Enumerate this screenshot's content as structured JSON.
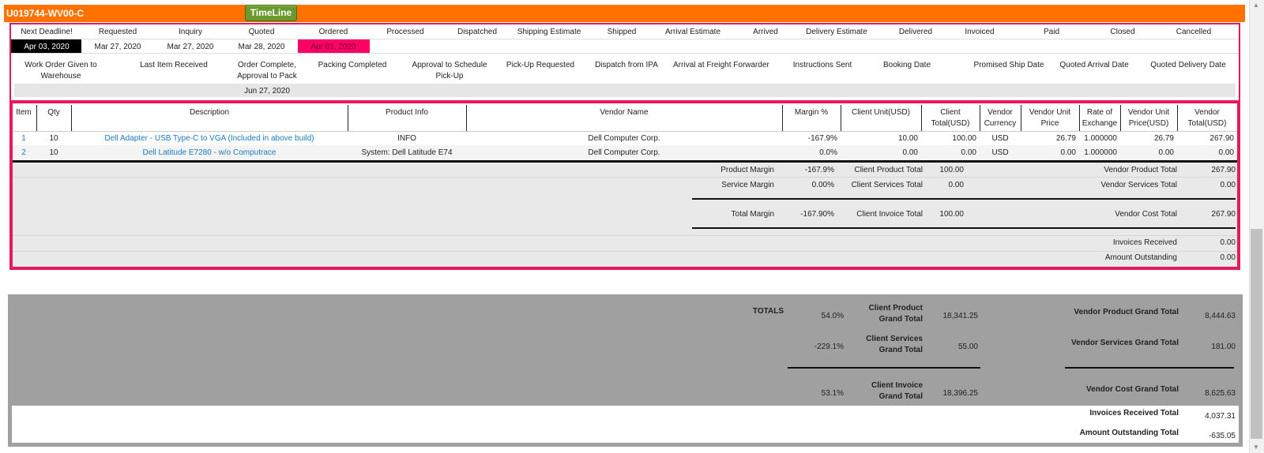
{
  "order": {
    "id": "U019744-WV00-C",
    "timeline_label": "TimeLine"
  },
  "status_headers": [
    "Next Deadline!",
    "Requested",
    "Inquiry",
    "Quoted",
    "Ordered",
    "Processed",
    "Dispatched",
    "Shipping Estimate",
    "Shipped",
    "Arrival Estimate",
    "Arrived",
    "Delivery Estimate",
    "Delivered",
    "Invoiced",
    "Paid",
    "Closed",
    "Cancelled"
  ],
  "status_values": [
    "Apr 03, 2020",
    "Mar 27, 2020",
    "Mar 27, 2020",
    "Mar 28, 2020",
    "Apr 01, 2020"
  ],
  "milestone_headers": [
    "Work Order Given to Warehouse",
    "Last Item Received",
    "Order Complete, Approval to Pack",
    "Packing Completed",
    "Approval to Schedule Pick-Up",
    "Pick-Up Requested",
    "Dispatch from IPA",
    "Arrival at Freight Forwarder",
    "Instructions Sent",
    "Booking Date",
    "Promised Ship Date",
    "Quoted Arrival Date",
    "Quoted Delivery Date"
  ],
  "milestone_values": {
    "order_complete": "Jun 27, 2020"
  },
  "items_table": {
    "headers": [
      "Item",
      "Qty",
      "Description",
      "Product Info",
      "Vendor Name",
      "Margin %",
      "Client Unit(USD)",
      "Client Total(USD)",
      "Vendor Currency",
      "Vendor Unit Price",
      "Rate of Exchange",
      "Vendor Unit Price(USD)",
      "Vendor Total(USD)"
    ],
    "rows": [
      [
        "1",
        "10",
        "Dell Adapter - USB Type-C to VGA (Included in above build)",
        "INFO",
        "Dell Computer Corp.",
        "-167.9%",
        "10.00",
        "100.00",
        "USD",
        "26.79",
        "1.000000",
        "26.79",
        "267.90"
      ],
      [
        "2",
        "10",
        "Dell Latitude E7280 - w/o Computrace",
        "System: Dell Latitude E74",
        "Dell Computer Corp.",
        "0.0%",
        "0.00",
        "0.00",
        "USD",
        "0.00",
        "1.000000",
        "0.00",
        "0.00"
      ]
    ]
  },
  "summary": {
    "product_margin_label": "Product Margin",
    "product_margin": "-167.9%",
    "client_product_total_label": "Client Product Total",
    "client_product_total": "100.00",
    "vendor_product_total_label": "Vendor Product Total",
    "vendor_product_total": "267.90",
    "service_margin_label": "Service Margin",
    "service_margin": "0.00%",
    "client_services_total_label": "Client Services Total",
    "client_services_total": "0.00",
    "vendor_services_total_label": "Vendor Services Total",
    "vendor_services_total": "0.00",
    "total_margin_label": "Total Margin",
    "total_margin": "-167.90%",
    "client_invoice_total_label": "Client Invoice Total",
    "client_invoice_total": "100.00",
    "vendor_cost_total_label": "Vendor Cost Total",
    "vendor_cost_total": "267.90",
    "invoices_received_label": "Invoices Received",
    "invoices_received": "0.00",
    "amount_outstanding_label": "Amount Outstanding",
    "amount_outstanding": "0.00"
  },
  "totals": {
    "label": "TOTALS",
    "product_margin": "54.0%",
    "client_product_label_1": "Client Product",
    "client_product_label_2": "Grand Total",
    "client_product_value": "18,341.25",
    "vendor_product_label": "Vendor Product Grand Total",
    "vendor_product_value": "8,444.63",
    "services_margin": "-229.1%",
    "client_services_label_1": "Client Services",
    "client_services_label_2": "Grand Total",
    "client_services_value": "55.00",
    "vendor_services_label": "Vendor Services Grand Total",
    "vendor_services_value": "181.00",
    "invoice_margin": "53.1%",
    "client_invoice_label_1": "Client Invoice",
    "client_invoice_label_2": "Grand Total",
    "client_invoice_value": "18,396.25",
    "vendor_cost_label": "Vendor Cost Grand Total",
    "vendor_cost_value": "8,625.63",
    "invoices_received_label": "Invoices Received Total",
    "invoices_received_value": "4,037.31",
    "amount_outstanding_label": "Amount Outstanding Total",
    "amount_outstanding_value": "-635.05"
  },
  "colors": {
    "header": "#ff7200",
    "border_pink": "#e8185a",
    "ordered_highlight": "#ff0066",
    "link_blue": "#1a7ac0",
    "totals_gray": "#a0a0a0"
  }
}
